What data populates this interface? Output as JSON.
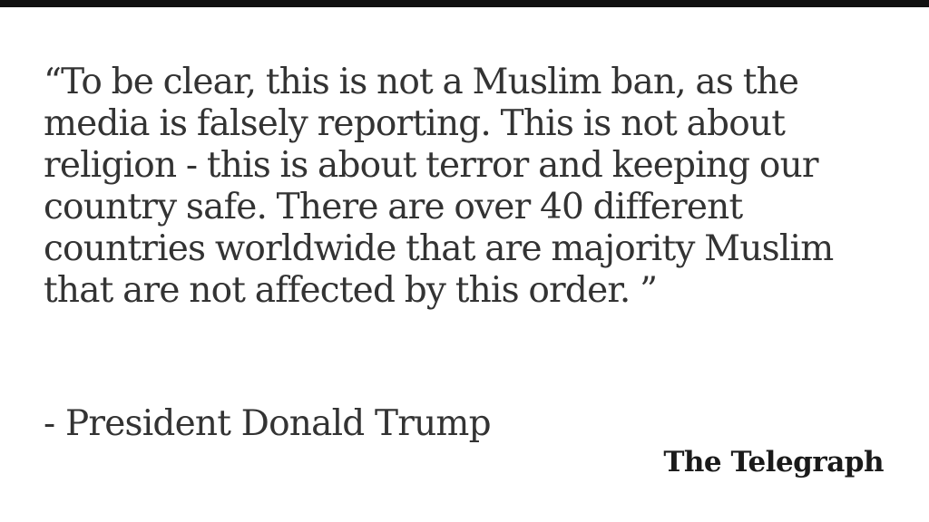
{
  "quote": {
    "lines": [
      "“To be clear, this is not a Muslim ban, as the",
      "media is falsely reporting. This is not about",
      "religion - this is about terror and keeping our",
      "country safe. There are over 40 different",
      "countries worldwide that are majority Muslim",
      "that are not affected by this order. ”"
    ]
  },
  "attribution": "- President Donald Trump",
  "logo": {
    "text": "The Telegraph"
  },
  "colors": {
    "background": "#ffffff",
    "top_bar": "#111111",
    "text": "#333333"
  }
}
